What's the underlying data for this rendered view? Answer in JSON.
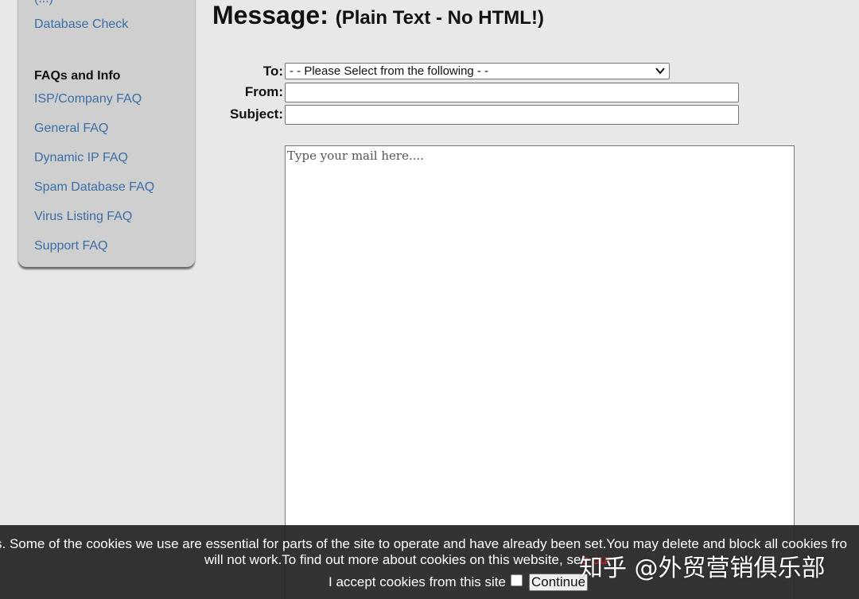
{
  "sidebar": {
    "clipped_item": "(...)",
    "top_links": [
      "Database Check"
    ],
    "faq_heading": "FAQs and Info",
    "faq_links": [
      "ISP/Company FAQ",
      "General FAQ",
      "Dynamic IP FAQ",
      "Spam Database FAQ",
      "Virus Listing FAQ",
      "Support FAQ"
    ]
  },
  "main": {
    "title": "Message:",
    "title_note": "(Plain Text - No HTML!)"
  },
  "form": {
    "to_label": "To:",
    "to_selected": "- - Please Select from the following - -",
    "from_label": "From:",
    "from_value": "",
    "subject_label": "Subject:",
    "subject_value": "",
    "message_placeholder": "Type your mail here...."
  },
  "cookie_bar": {
    "line1": "s. Some of the cookies we use are essential for parts of the site to operate and have already been set.You may delete and block all cookies fro",
    "line2_text": "will not work.To find out more about cookies on this website, se",
    "line2_link": "e our",
    "accept_label": "I accept cookies from this site",
    "accept_checked": false,
    "continue_label": "Continue"
  },
  "watermark": "知乎 @外贸营销俱乐部"
}
